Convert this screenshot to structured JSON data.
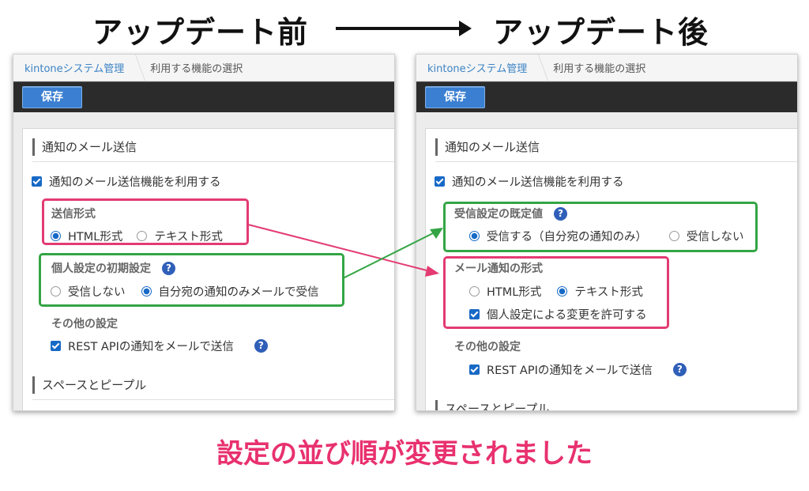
{
  "header": {
    "before": "アップデート前",
    "after": "アップデート後"
  },
  "footer": {
    "caption": "設定の並び順が変更されました"
  },
  "colors": {
    "pink": "#e33b72",
    "green": "#33a544",
    "accent": "#1769c6",
    "toolbar": "#2b2b2b"
  },
  "left": {
    "breadcrumb": {
      "home": "kintoneシステム管理",
      "current": "利用する機能の選択"
    },
    "save": "保存",
    "section_mail": "通知のメール送信",
    "enable": "通知のメール送信機能を利用する",
    "format_title": "送信形式",
    "format_html": "HTML形式",
    "format_text": "テキスト形式",
    "personal_title": "個人設定の初期設定",
    "personal_no": "受信しない",
    "personal_own": "自分宛の通知のみメールで受信",
    "other_title": "その他の設定",
    "rest": "REST APIの通知をメールで送信",
    "section_space": "スペースとピープル"
  },
  "right": {
    "breadcrumb": {
      "home": "kintoneシステム管理",
      "current": "利用する機能の選択"
    },
    "save": "保存",
    "section_mail": "通知のメール送信",
    "enable": "通知のメール送信機能を利用する",
    "receive_title": "受信設定の既定値",
    "receive_yes": "受信する（自分宛の通知のみ）",
    "receive_no": "受信しない",
    "format_title": "メール通知の形式",
    "format_html": "HTML形式",
    "format_text": "テキスト形式",
    "allow_change": "個人設定による変更を許可する",
    "other_title": "その他の設定",
    "rest": "REST APIの通知をメールで送信",
    "section_space": "スペースとピープル"
  }
}
